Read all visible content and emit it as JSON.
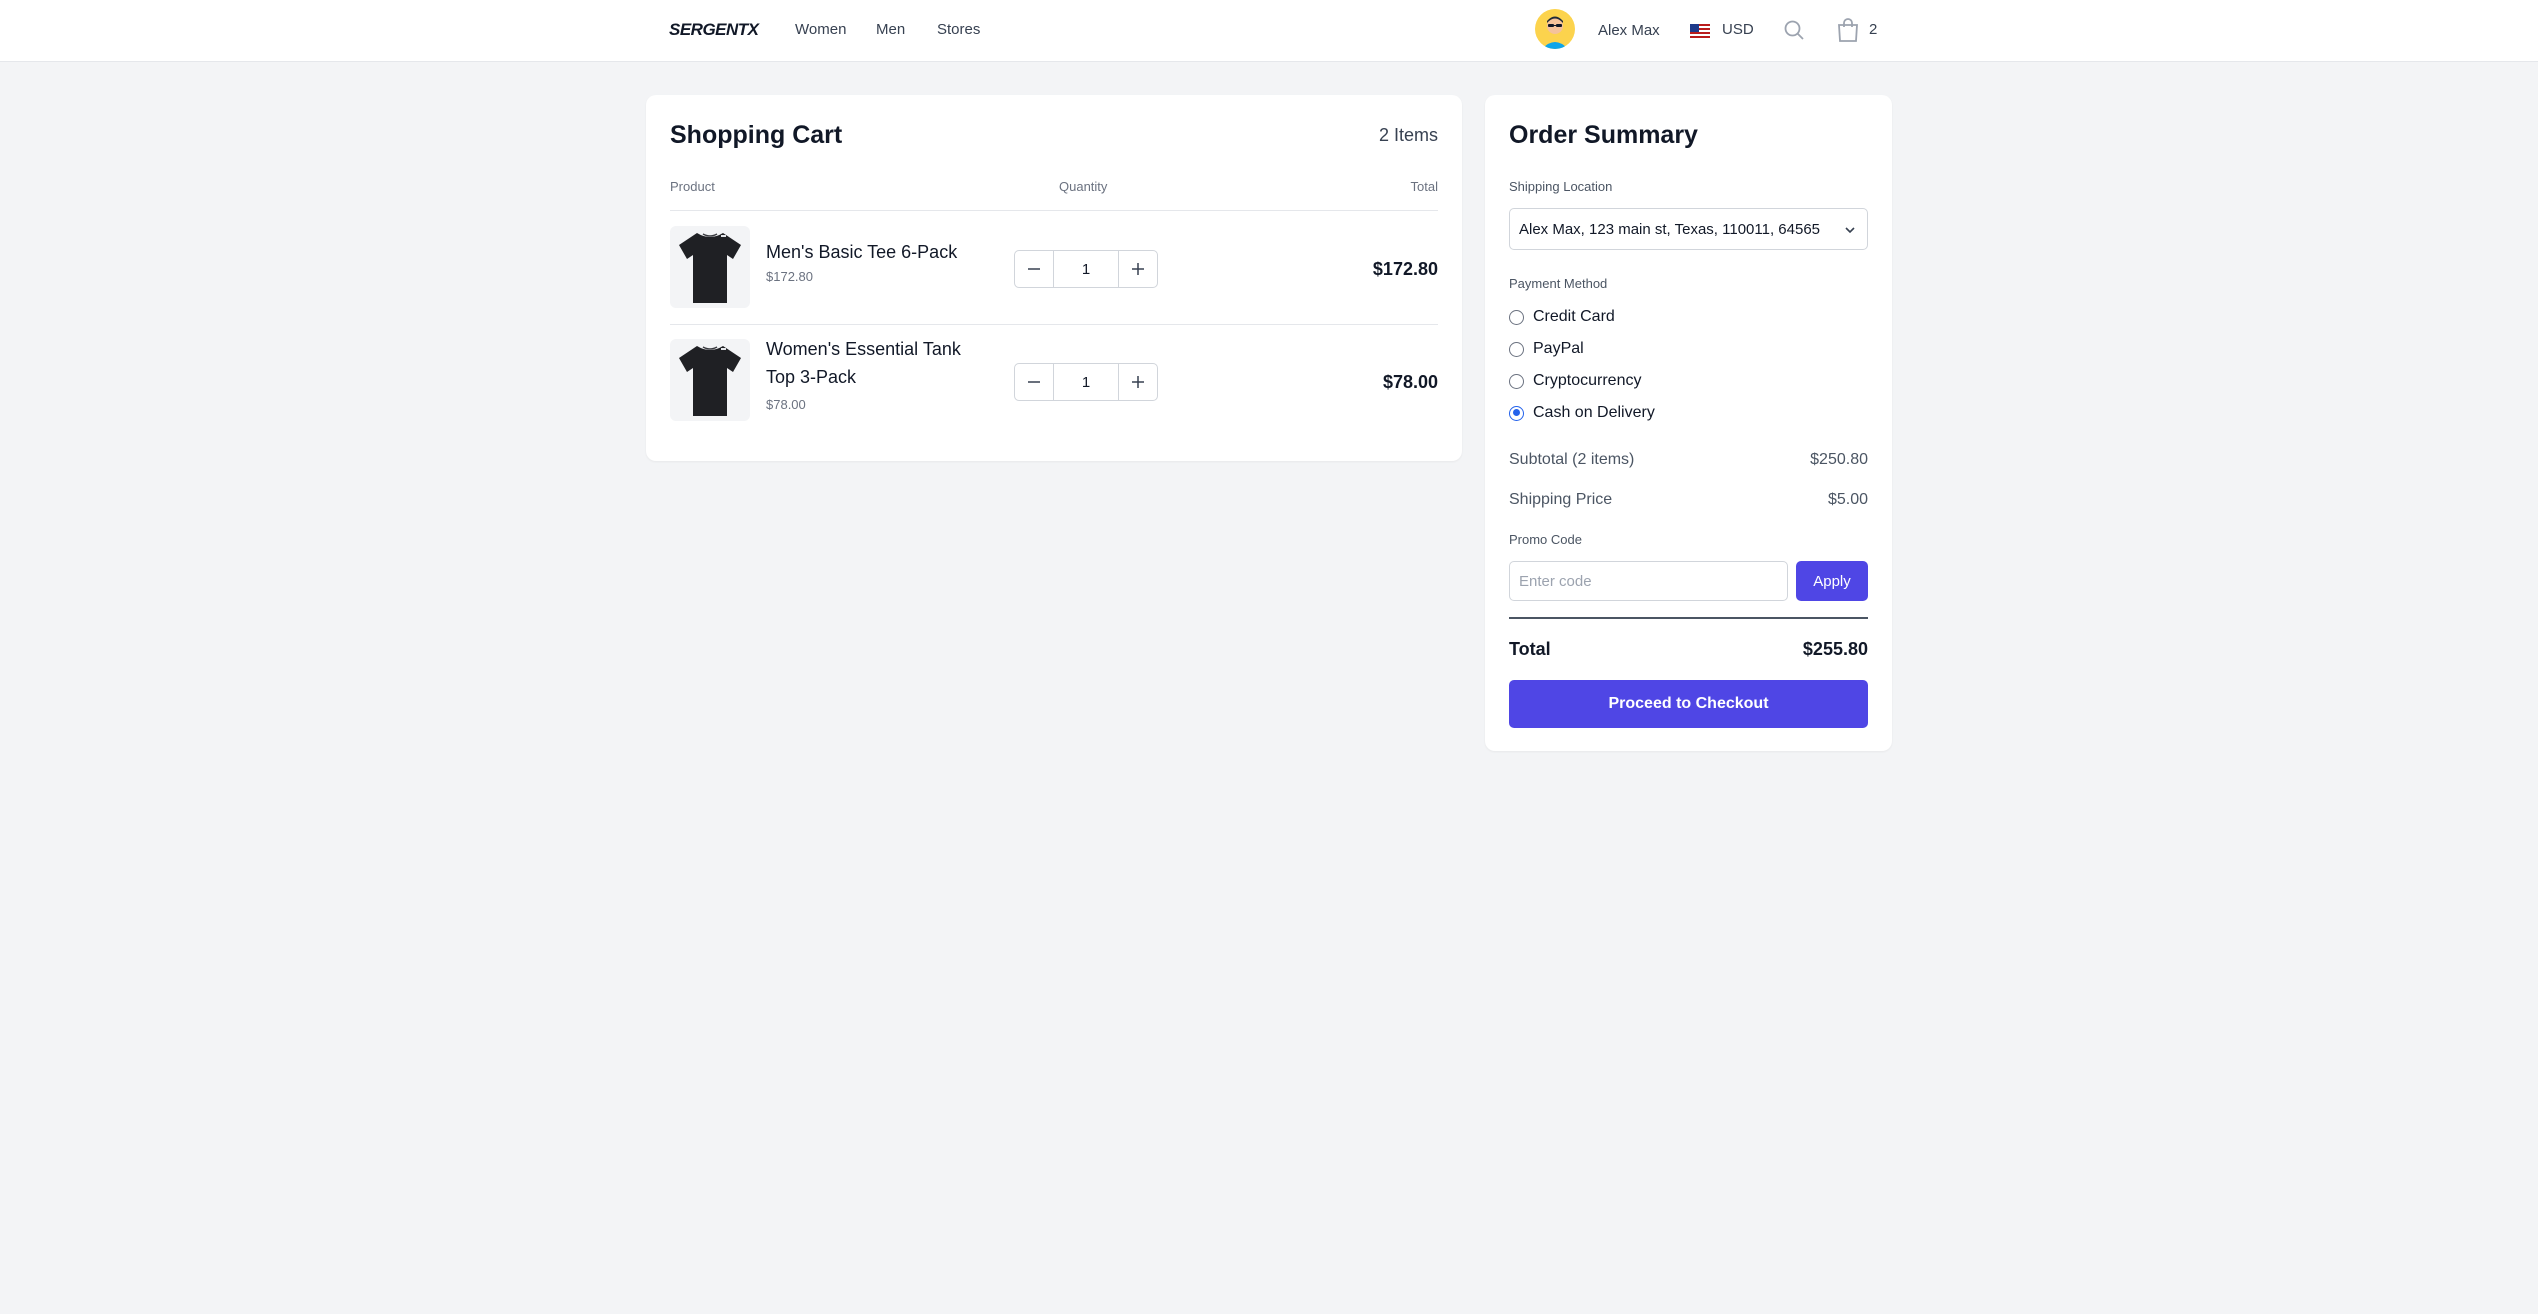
{
  "header": {
    "logo": "SERGENTX",
    "nav": [
      "Women",
      "Men",
      "Stores"
    ],
    "user_name": "Alex Max",
    "currency": "USD",
    "cart_count": "2"
  },
  "cart": {
    "title": "Shopping Cart",
    "item_count_label": "2 Items",
    "columns": {
      "product": "Product",
      "quantity": "Quantity",
      "total": "Total"
    },
    "items": [
      {
        "name": "Men's Basic Tee 6-Pack",
        "price": "$172.80",
        "quantity": "1",
        "total": "$172.80"
      },
      {
        "name": "Women's Essential Tank Top 3-Pack",
        "price": "$78.00",
        "quantity": "1",
        "total": "$78.00"
      }
    ]
  },
  "summary": {
    "title": "Order Summary",
    "shipping_label": "Shipping Location",
    "shipping_value": "Alex Max, 123 main st, Texas, 110011, 64565",
    "payment_label": "Payment Method",
    "payment_options": [
      "Credit Card",
      "PayPal",
      "Cryptocurrency",
      "Cash on Delivery"
    ],
    "payment_selected": "Cash on Delivery",
    "subtotal_label": "Subtotal (2 items)",
    "subtotal_value": "$250.80",
    "shipping_price_label": "Shipping Price",
    "shipping_price_value": "$5.00",
    "promo_label": "Promo Code",
    "promo_placeholder": "Enter code",
    "apply_label": "Apply",
    "total_label": "Total",
    "total_value": "$255.80",
    "checkout_label": "Proceed to Checkout"
  },
  "colors": {
    "accent": "#4f46e5",
    "radio_checked": "#2563eb",
    "background": "#f3f4f6"
  },
  "icons": [
    "avatar",
    "us-flag-icon",
    "search-icon",
    "shopping-bag-icon",
    "chevron-down-icon",
    "minus-icon",
    "plus-icon",
    "tshirt-icon"
  ]
}
